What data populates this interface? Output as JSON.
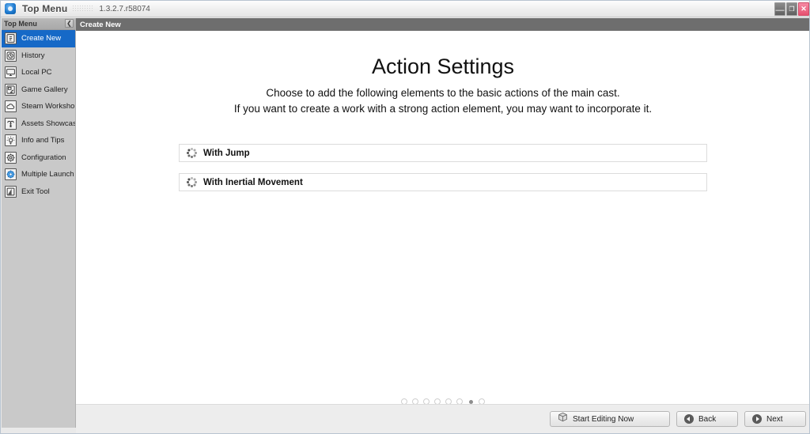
{
  "window": {
    "app_icon": "app-logo-icon",
    "title": "Top Menu",
    "version": "1.3.2.7.r58074",
    "controls": {
      "minimize": "—",
      "maximize": "❐",
      "close": "✕"
    },
    "accent_color": "#1669c7",
    "close_color": "#e8506f"
  },
  "sidebar": {
    "header_label": "Top Menu",
    "collapse_icon": "❮",
    "items": [
      {
        "label": "Create New",
        "icon": "new-document-icon",
        "active": true
      },
      {
        "label": "History",
        "icon": "history-clock-icon",
        "active": false
      },
      {
        "label": "Local PC",
        "icon": "monitor-icon",
        "active": false
      },
      {
        "label": "Game Gallery",
        "icon": "game-gallery-icon",
        "active": false
      },
      {
        "label": "Steam Workshop",
        "icon": "cloud-icon",
        "active": false
      },
      {
        "label": "Assets Showcase",
        "icon": "assets-icon",
        "active": false
      },
      {
        "label": "Info and Tips",
        "icon": "lightbulb-icon",
        "active": false
      },
      {
        "label": "Configuration",
        "icon": "gear-icon",
        "active": false
      },
      {
        "label": "Multiple Launch",
        "icon": "multi-launch-icon",
        "active": false
      },
      {
        "label": "Exit Tool",
        "icon": "exit-door-icon",
        "active": false
      }
    ]
  },
  "breadcrumb": {
    "label": "Create New"
  },
  "main": {
    "title": "Action Settings",
    "subtitle_line1": "Choose to add the following elements to the basic actions of the main cast.",
    "subtitle_line2": "If you want to create a work with a strong action element, you may want to incorporate it.",
    "options": [
      {
        "label": "With Jump",
        "icon": "dotted-circle-icon",
        "checked": false
      },
      {
        "label": "With Inertial Movement",
        "icon": "dotted-circle-icon",
        "checked": false
      }
    ]
  },
  "pager": {
    "total": 8,
    "active_index": 7
  },
  "footer": {
    "start_editing_label": "Start Editing Now",
    "start_editing_icon": "box-icon",
    "back_label": "Back",
    "back_icon": "arrow-left-circle-icon",
    "next_label": "Next",
    "next_icon": "arrow-right-circle-icon"
  }
}
